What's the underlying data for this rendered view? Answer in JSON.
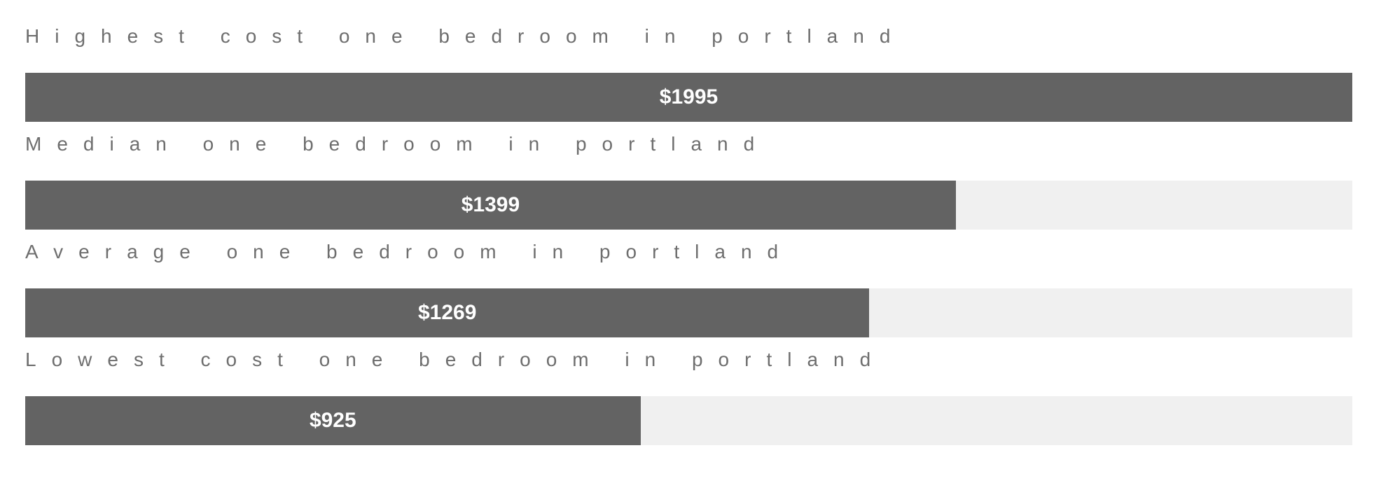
{
  "chart_data": {
    "type": "bar",
    "orientation": "horizontal",
    "categories": [
      "Highest cost one bedroom in portland",
      "Median one bedroom in portland",
      "Average one bedroom in portland",
      "Lowest cost one bedroom in portland"
    ],
    "values": [
      1995,
      1399,
      1269,
      925
    ],
    "value_labels": [
      "$1995",
      "$1399",
      "$1269",
      "$925"
    ],
    "xlim": [
      0,
      1995
    ],
    "grid": false,
    "colors": {
      "bar": "#636363",
      "track": "#f0f0f0",
      "label": "#6e6e6e",
      "value_text": "#ffffff"
    }
  }
}
